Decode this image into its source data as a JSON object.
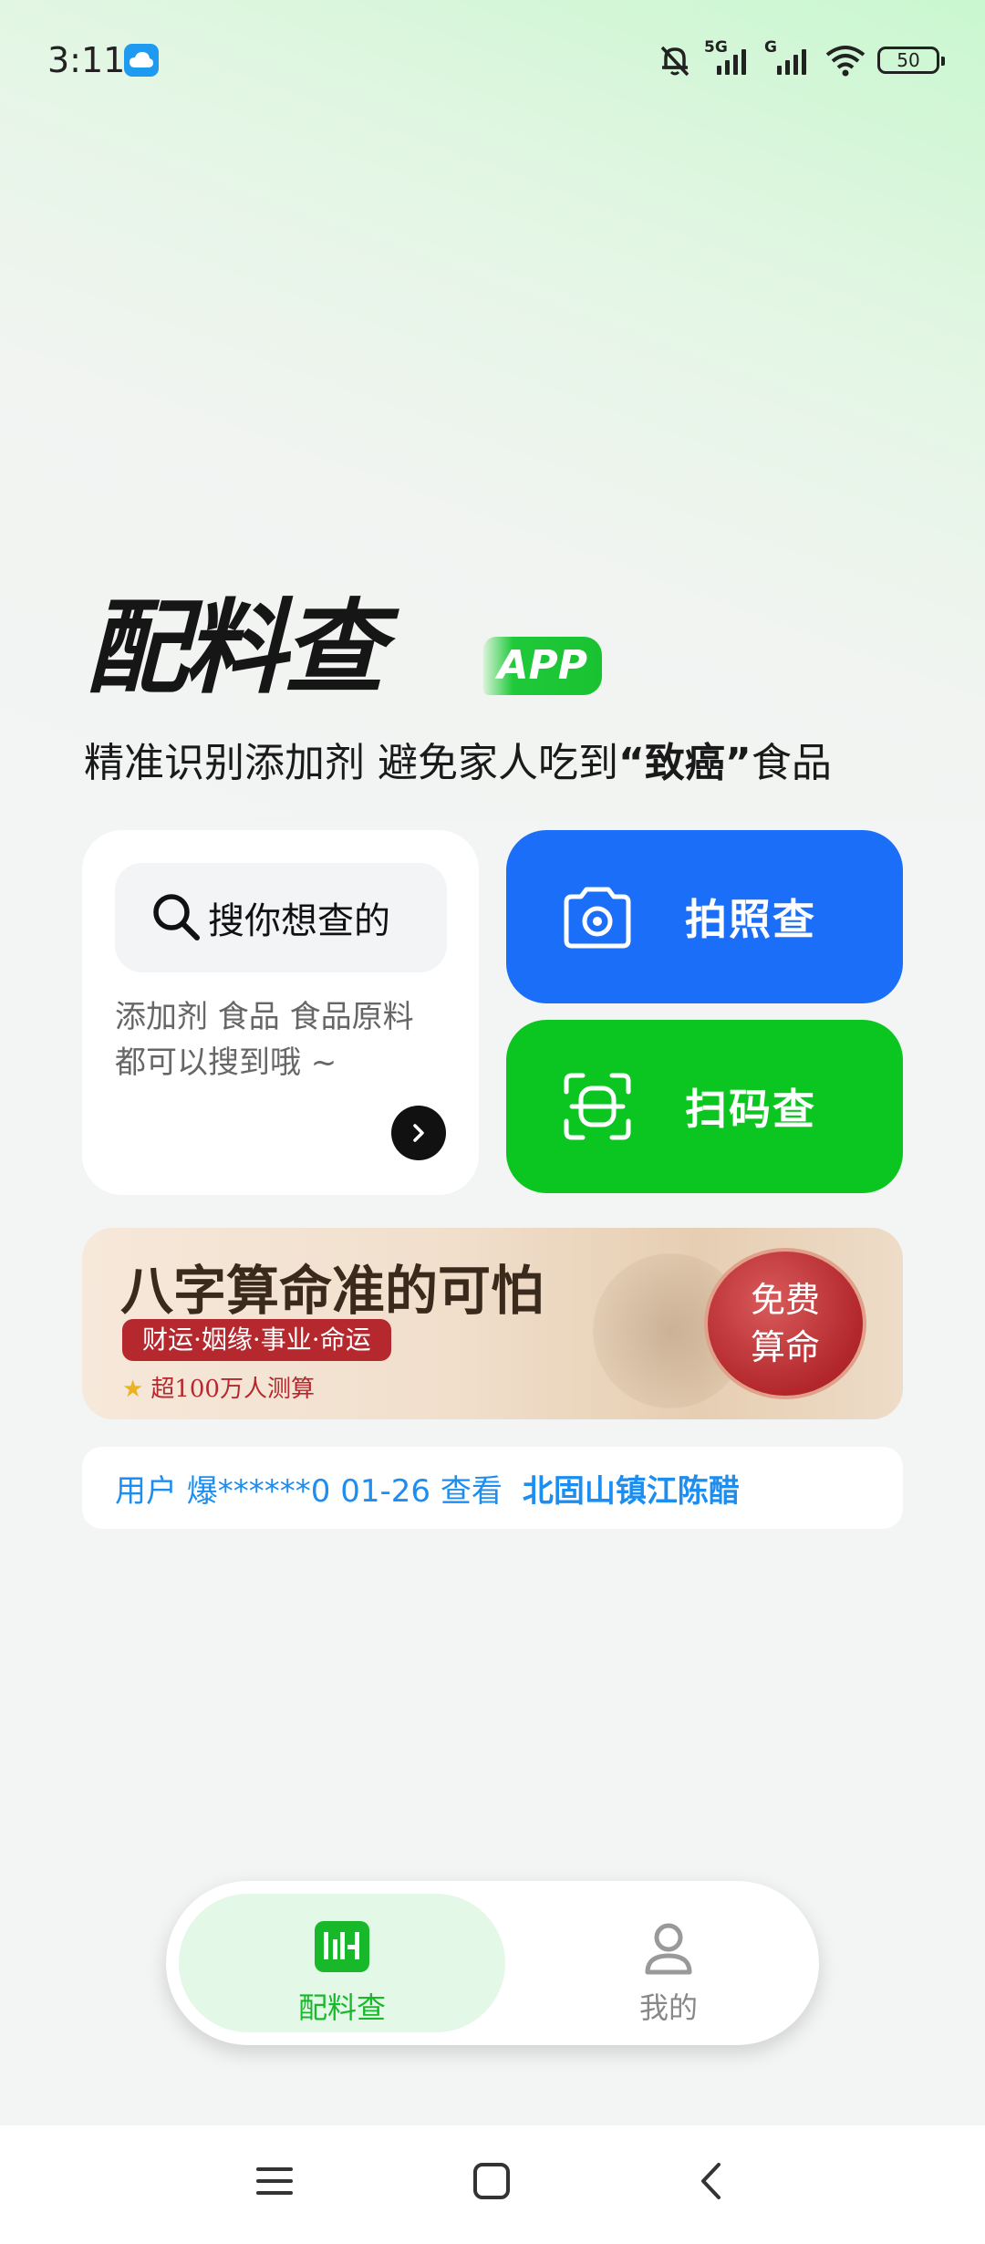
{
  "status_bar": {
    "time": "3:11",
    "network_1": "5G",
    "network_2": "G",
    "battery": "50",
    "icons": [
      "cloud-app-icon",
      "mute-bell-icon",
      "signal-icon",
      "wifi-icon",
      "battery-icon"
    ]
  },
  "hero": {
    "app_name": "配料查",
    "app_badge": "APP",
    "tagline_part1": "精准识别添加剂 避免家人吃到",
    "tagline_emph": "“致癌”",
    "tagline_part2": "食品"
  },
  "search": {
    "placeholder": "搜你想查的",
    "desc_line1": "添加剂 食品 食品原料",
    "desc_line2": "都可以搜到哦 ~"
  },
  "actions": {
    "photo_label": "拍照查",
    "scan_label": "扫码查"
  },
  "banner": {
    "title": "八字算命准的可怕",
    "tags": "财运·姻缘·事业·命运",
    "count": "超100万人测算",
    "cta_line1": "免费",
    "cta_line2": "算命"
  },
  "notice": {
    "text": "用户 爆******0 01-26 查看",
    "product": "北固山镇江陈醋"
  },
  "tabbar": {
    "home_label": "配料查",
    "mine_label": "我的"
  },
  "colors": {
    "accent_green": "#0bc520",
    "accent_blue": "#1a6ef8",
    "notice_blue": "#1d8ef0",
    "banner_red": "#b5282e"
  }
}
